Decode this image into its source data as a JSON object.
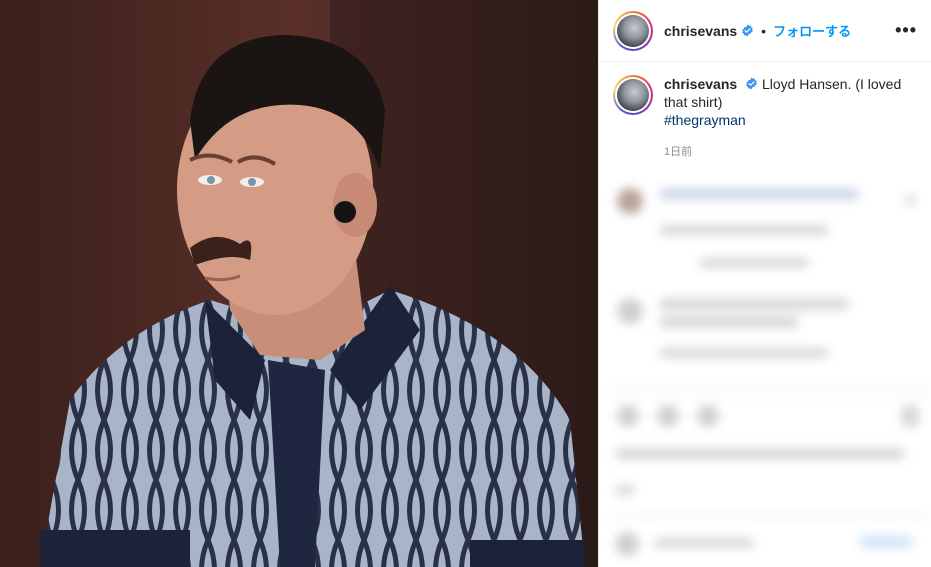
{
  "post": {
    "username": "chrisevans",
    "follow_label": "フォローする",
    "separator": "•",
    "more_label": "•••",
    "caption_text": "Lloyd Hansen. (I loved that shirt)",
    "hashtag": "#thegrayman",
    "timestamp": "1日前"
  },
  "colors": {
    "accent": "#0095f6",
    "verified": "#3897f0",
    "hashtag": "#00376b",
    "muted": "#8e8e8e"
  },
  "icons": {
    "verified": "verified-badge-icon",
    "more": "more-options-icon"
  }
}
